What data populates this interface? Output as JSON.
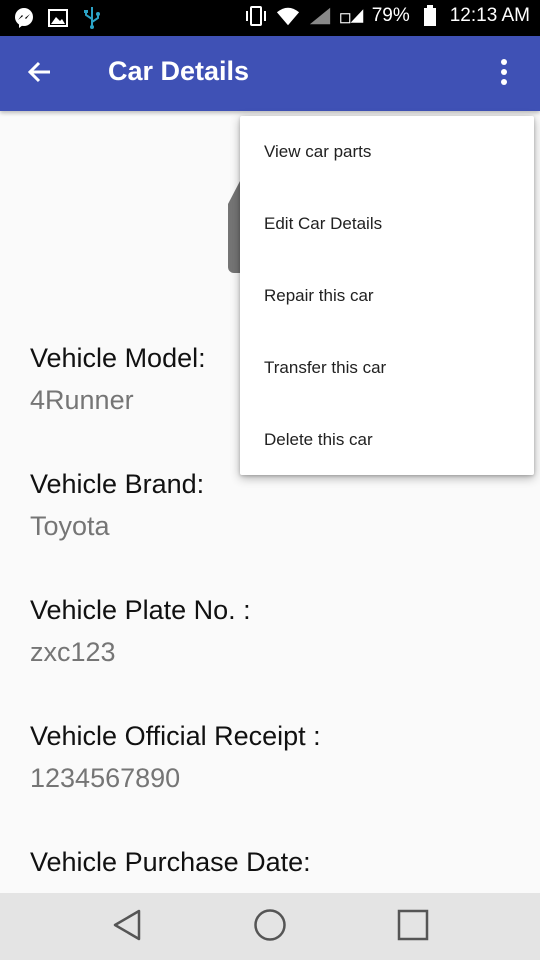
{
  "status_bar": {
    "battery": "79%",
    "time": "12:13 AM",
    "icons": [
      "messenger-icon",
      "gallery-icon",
      "usb-icon",
      "vibrate-icon",
      "wifi-icon",
      "signal-icon",
      "lte-signal-icon",
      "battery-icon"
    ]
  },
  "app_bar": {
    "title": "Car Details",
    "icons": [
      "back-arrow-icon",
      "overflow-menu-icon"
    ]
  },
  "details": {
    "model_label": "Vehicle Model:",
    "model_value": "4Runner",
    "brand_label": "Vehicle Brand:",
    "brand_value": "Toyota",
    "plate_label": "Vehicle Plate No. :",
    "plate_value": "zxc123",
    "receipt_label": "Vehicle Official Receipt :",
    "receipt_value": "1234567890",
    "purchase_label": "Vehicle Purchase Date:"
  },
  "menu": {
    "items": [
      "View car parts",
      "Edit Car Details",
      "Repair this car",
      "Transfer this car",
      "Delete this car"
    ]
  },
  "nav_bar": {
    "icons": [
      "back-triangle-icon",
      "home-circle-icon",
      "recents-square-icon"
    ]
  },
  "colors": {
    "app_bar": "#3f51b5",
    "status_bar": "#000000",
    "label_text": "#111111",
    "value_text": "#757575",
    "nav_bar": "#e4e4e4"
  }
}
